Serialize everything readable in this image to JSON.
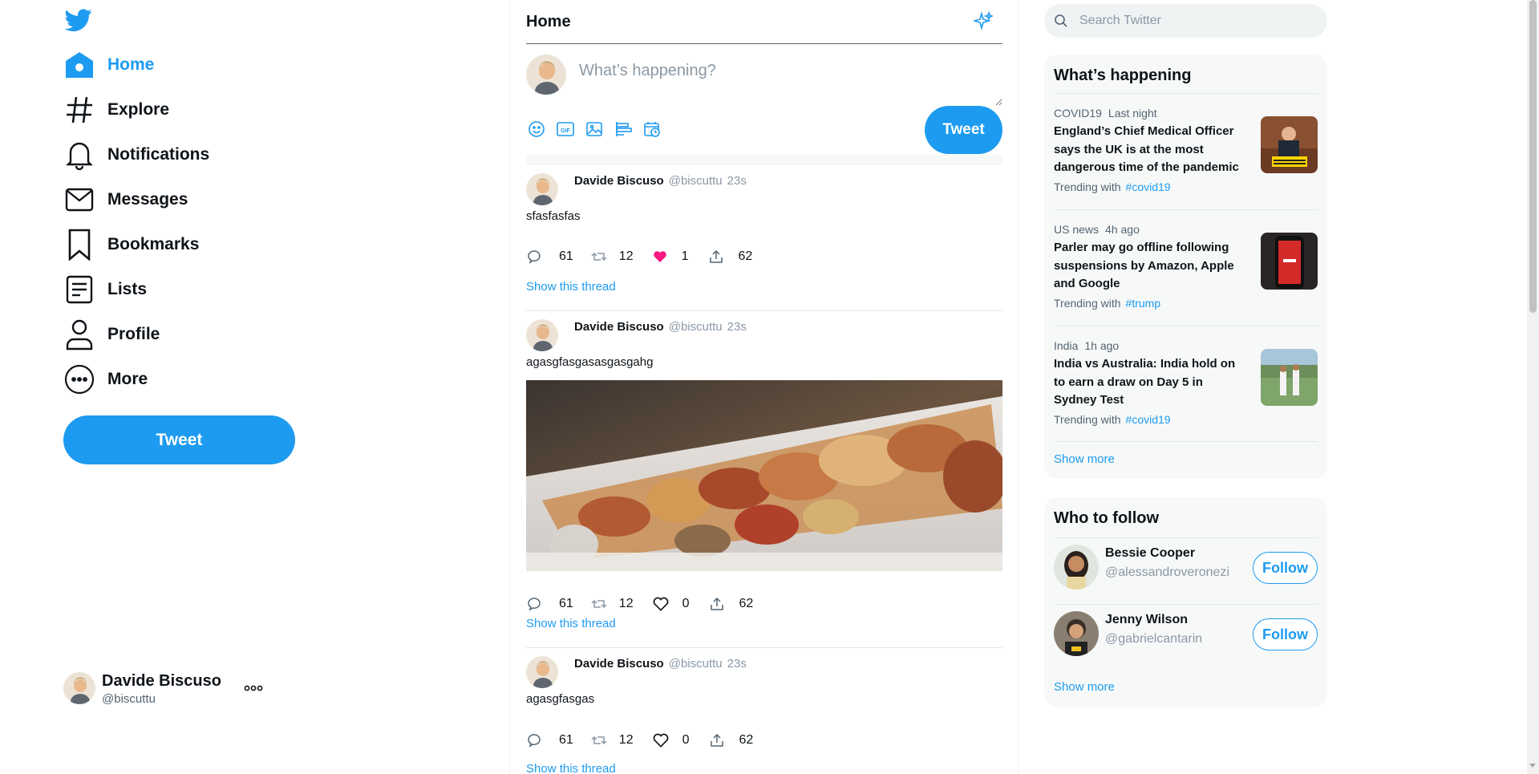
{
  "sidebar": {
    "nav": [
      {
        "label": "Home",
        "icon": "home-icon",
        "active": true
      },
      {
        "label": "Explore",
        "icon": "hashtag-icon"
      },
      {
        "label": "Notifications",
        "icon": "bell-icon"
      },
      {
        "label": "Messages",
        "icon": "envelope-icon"
      },
      {
        "label": "Bookmarks",
        "icon": "bookmark-icon"
      },
      {
        "label": "Lists",
        "icon": "list-icon"
      },
      {
        "label": "Profile",
        "icon": "person-icon"
      },
      {
        "label": "More",
        "icon": "more-circle-icon"
      }
    ],
    "tweet_button": "Tweet",
    "account": {
      "name": "Davide Biscuso",
      "handle": "@biscuttu"
    }
  },
  "main": {
    "title": "Home",
    "composer": {
      "placeholder": "What’s happening?",
      "tweet_button": "Tweet"
    },
    "tweets": [
      {
        "name": "Davide Biscuso",
        "handle": "@biscuttu",
        "time": "23s",
        "text": "sfasfasfas",
        "replies": "61",
        "retweets": "12",
        "likes": "1",
        "liked": true,
        "shares": "62",
        "thread_link": "Show this thread"
      },
      {
        "name": "Davide Biscuso",
        "handle": "@biscuttu",
        "time": "23s",
        "text": "agasgfasgasasgasgahg",
        "has_image": true,
        "replies": "61",
        "retweets": "12",
        "likes": "0",
        "shares": "62",
        "thread_link": "Show this thread"
      },
      {
        "name": "Davide Biscuso",
        "handle": "@biscuttu",
        "time": "23s",
        "text": "agasgfasgas",
        "replies": "61",
        "retweets": "12",
        "likes": "0",
        "shares": "62",
        "thread_link": "Show this thread"
      }
    ]
  },
  "right": {
    "search_placeholder": "Search Twitter",
    "happening": {
      "title": "What’s happening",
      "trends": [
        {
          "category": "COVID19",
          "time": "Last night",
          "title": "England’s Chief Medical Officer says the UK is at the most dangerous time of the pandemic",
          "with_label": "Trending with",
          "tag": "#covid19"
        },
        {
          "category": "US news",
          "time": "4h ago",
          "title": "Parler may go offline following suspensions by Amazon, Apple and Google",
          "with_label": "Trending with",
          "tag": "#trump"
        },
        {
          "category": "India",
          "time": "1h ago",
          "title": "India vs Australia: India hold on to earn a draw on Day 5 in Sydney Test",
          "with_label": "Trending with",
          "tag": "#covid19"
        }
      ],
      "show_more": "Show more"
    },
    "who_to_follow": {
      "title": "Who to follow",
      "users": [
        {
          "name": "Bessie Cooper",
          "handle": "@alessandroveronezi",
          "button": "Follow"
        },
        {
          "name": "Jenny Wilson",
          "handle": "@gabrielcantarin",
          "button": "Follow"
        }
      ],
      "show_more": "Show more"
    }
  },
  "colors": {
    "accent": "#1d9bf0",
    "like": "#f91880",
    "text": "#0f1419",
    "muted": "#536471",
    "panel": "#f7f9f9"
  }
}
